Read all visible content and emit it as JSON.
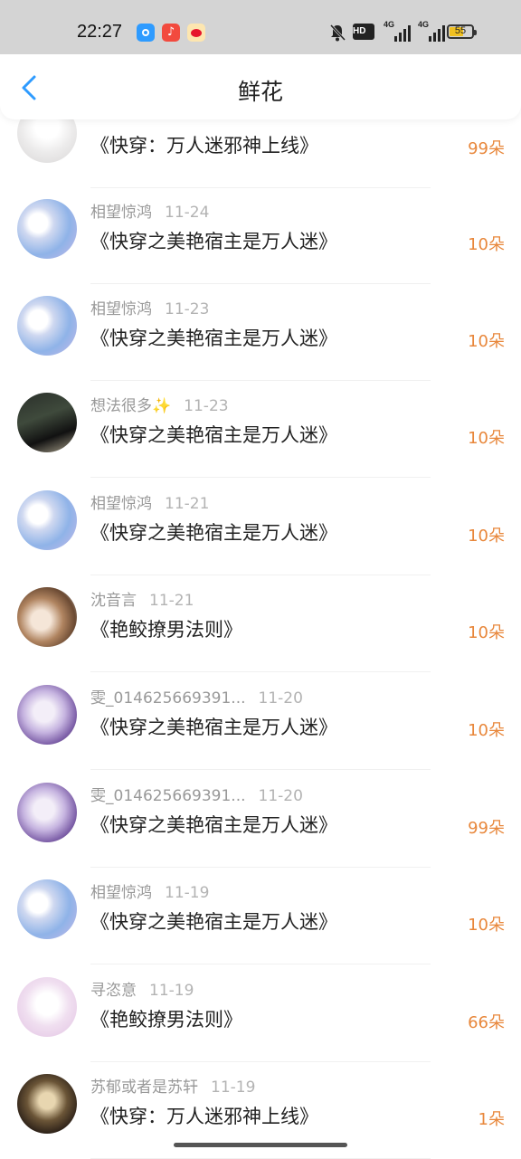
{
  "status_bar": {
    "time": "22:27",
    "network_1": "4G",
    "network_2": "4G",
    "hd_label": "HD",
    "battery": "55",
    "battery_level": 0.55
  },
  "header": {
    "title": "鲜花",
    "back_icon": "chevron-left-icon"
  },
  "colors": {
    "accent": "#2e9bff",
    "count": "#e8873b"
  },
  "items": [
    {
      "user": "",
      "date": "",
      "book": "《快穿：万人迷邪神上线》",
      "count": "99朵",
      "avatar": "white"
    },
    {
      "user": "相望惊鸿",
      "date": "11-24",
      "book": "《快穿之美艳宿主是万人迷》",
      "count": "10朵",
      "avatar": "blue"
    },
    {
      "user": "相望惊鸿",
      "date": "11-23",
      "book": "《快穿之美艳宿主是万人迷》",
      "count": "10朵",
      "avatar": "blue"
    },
    {
      "user": "想法很多✨",
      "date": "11-23",
      "book": "《快穿之美艳宿主是万人迷》",
      "count": "10朵",
      "avatar": "dark"
    },
    {
      "user": "相望惊鸿",
      "date": "11-21",
      "book": "《快穿之美艳宿主是万人迷》",
      "count": "10朵",
      "avatar": "blue"
    },
    {
      "user": "沈音言",
      "date": "11-21",
      "book": "《艳鲛撩男法则》",
      "count": "10朵",
      "avatar": "brown"
    },
    {
      "user": "雯_014625669391...",
      "date": "11-20",
      "book": "《快穿之美艳宿主是万人迷》",
      "count": "10朵",
      "avatar": "purple"
    },
    {
      "user": "雯_014625669391...",
      "date": "11-20",
      "book": "《快穿之美艳宿主是万人迷》",
      "count": "99朵",
      "avatar": "purple"
    },
    {
      "user": "相望惊鸿",
      "date": "11-19",
      "book": "《快穿之美艳宿主是万人迷》",
      "count": "10朵",
      "avatar": "blue"
    },
    {
      "user": "寻恣意",
      "date": "11-19",
      "book": "《艳鲛撩男法则》",
      "count": "66朵",
      "avatar": "pink"
    },
    {
      "user": "苏郁或者是苏轩",
      "date": "11-19",
      "book": "《快穿：万人迷邪神上线》",
      "count": "1朵",
      "avatar": "gold"
    }
  ]
}
